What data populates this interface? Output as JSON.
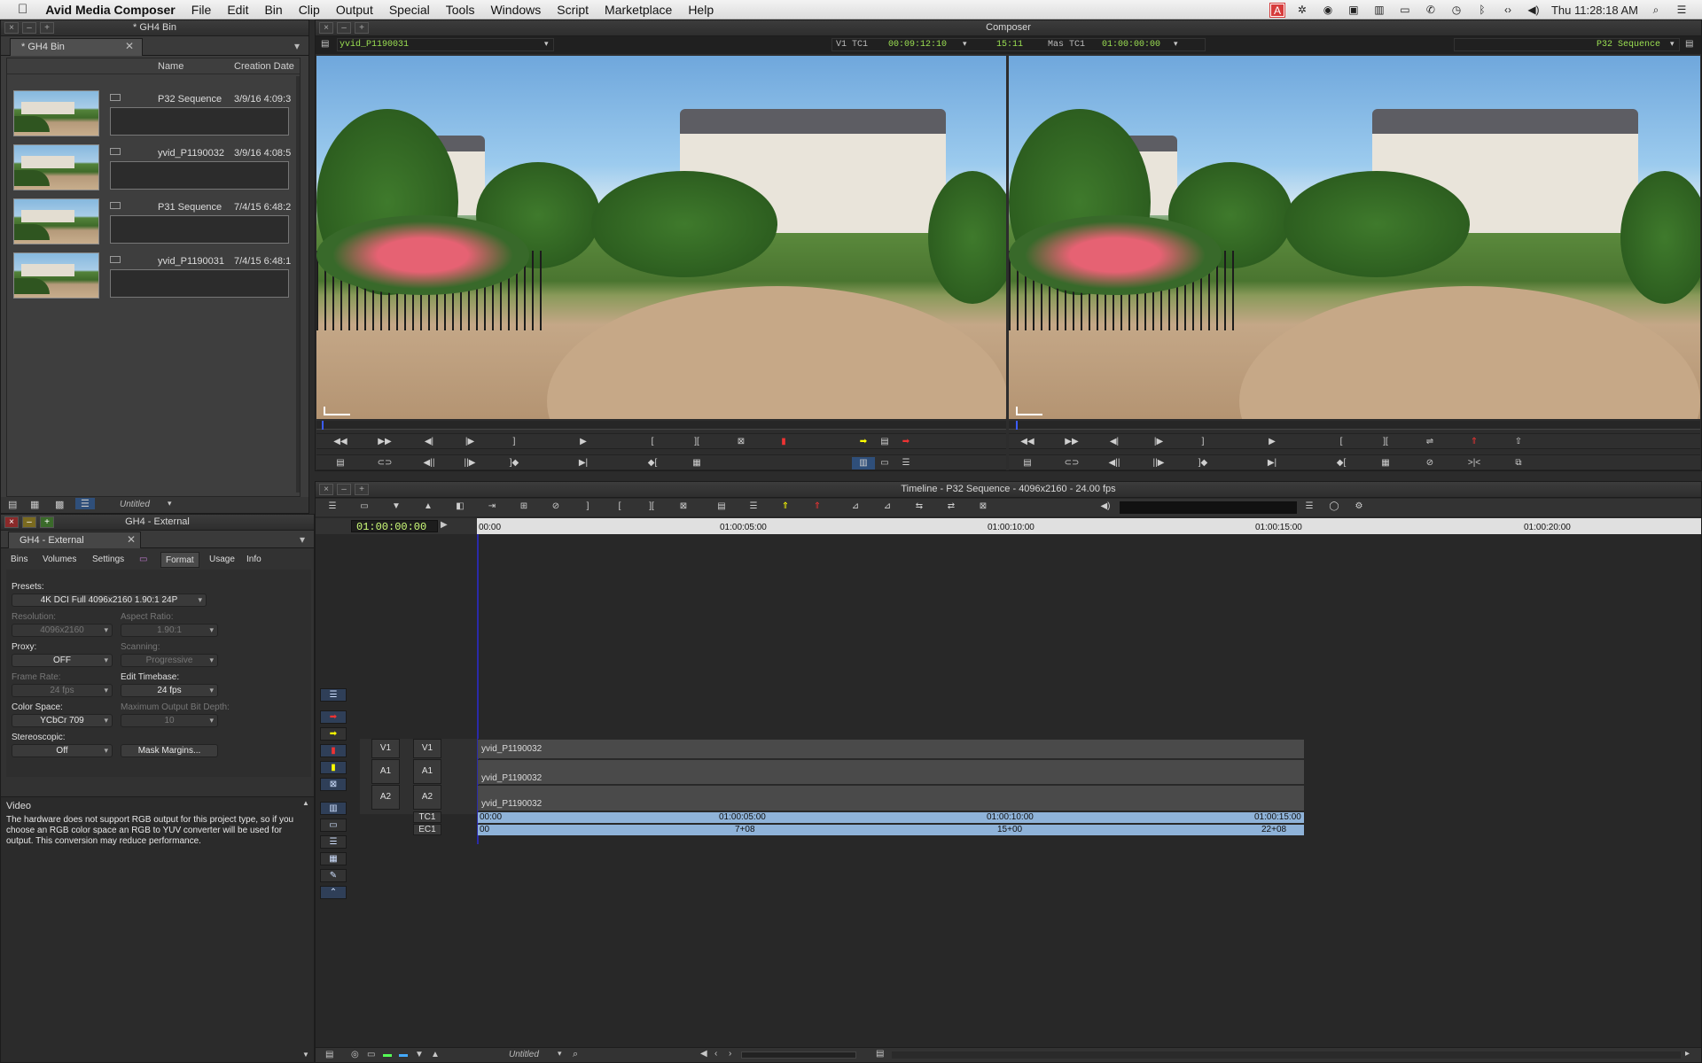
{
  "menubar": {
    "apple": "",
    "app": "Avid Media Composer",
    "items": [
      "File",
      "Edit",
      "Bin",
      "Clip",
      "Output",
      "Special",
      "Tools",
      "Windows",
      "Script",
      "Marketplace",
      "Help"
    ],
    "clock": "Thu 11:28:18 AM"
  },
  "bin": {
    "window_title": "* GH4 Bin",
    "tab": "* GH4 Bin",
    "col_name": "Name",
    "col_date": "Creation Date",
    "items": [
      {
        "name": "P32 Sequence",
        "date": "3/9/16 4:09:3"
      },
      {
        "name": "yvid_P1190032",
        "date": "3/9/16 4:08:5"
      },
      {
        "name": "P31 Sequence",
        "date": "7/4/15 6:48:2"
      },
      {
        "name": "yvid_P1190031",
        "date": "7/4/15 6:48:1"
      }
    ],
    "footer_label": "Untitled"
  },
  "settings": {
    "window_title": "GH4 - External",
    "tab": "GH4 - External",
    "subtabs": [
      "Bins",
      "Volumes",
      "Settings",
      "",
      "Format",
      "Usage",
      "Info"
    ],
    "presets_label": "Presets:",
    "presets_value": "4K DCI Full 4096x2160 1.90:1 24P",
    "resolution_label": "Resolution:",
    "resolution_value": "4096x2160",
    "aspect_label": "Aspect Ratio:",
    "aspect_value": "1.90:1",
    "proxy_label": "Proxy:",
    "proxy_value": "OFF",
    "scanning_label": "Scanning:",
    "scanning_value": "Progressive",
    "framerate_label": "Frame Rate:",
    "framerate_value": "24 fps",
    "timebase_label": "Edit Timebase:",
    "timebase_value": "24 fps",
    "colorspace_label": "Color Space:",
    "colorspace_value": "YCbCr 709",
    "bitdepth_label": "Maximum Output Bit Depth:",
    "bitdepth_value": "10",
    "stereo_label": "Stereoscopic:",
    "stereo_value": "Off",
    "mask_button": "Mask Margins...",
    "video_heading": "Video",
    "video_note": "The hardware does not support RGB output for this project type, so if you choose an RGB color space an RGB to YUV converter will be used for output.  This conversion may reduce performance."
  },
  "composer": {
    "title": "Composer",
    "source_clip": "yvid_P1190031",
    "v1_label": "V1 TC1",
    "v1_tc": "00:09:12:10",
    "dur": "15:11",
    "mas_label": "Mas TC1",
    "mas_tc": "01:00:00:00",
    "record_seq": "P32 Sequence"
  },
  "timeline": {
    "title": "Timeline - P32 Sequence - 4096x2160 - 24.00 fps",
    "position": "01:00:00:00",
    "ruler": [
      "00:00",
      "01:00:05:00",
      "01:00:10:00",
      "01:00:15:00",
      "01:00:20:00"
    ],
    "tracks": [
      {
        "src": "V1",
        "rec": "V1",
        "clip": "yvid_P1190032"
      },
      {
        "src": "A1",
        "rec": "A1",
        "clip": "yvid_P1190032"
      },
      {
        "src": "A2",
        "rec": "A2",
        "clip": "yvid_P1190032"
      }
    ],
    "tc1_label": "TC1",
    "ec1_label": "EC1",
    "tc_marks": [
      "00:00",
      "01:00:05:00",
      "01:00:10:00",
      "01:00:15:00"
    ],
    "ec_marks": [
      "00",
      "7+08",
      "15+00",
      "22+08"
    ],
    "footer_label": "Untitled"
  }
}
